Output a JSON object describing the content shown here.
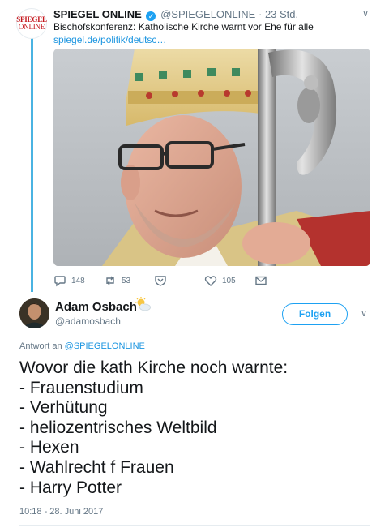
{
  "parent_tweet": {
    "author_name": "SPIEGEL ONLINE",
    "avatar_lines": [
      "SPIEGEL",
      "ONLINE"
    ],
    "verified_icon": "verified-badge-icon",
    "handle": "@SPIEGELONLINE",
    "separator": "·",
    "time": "23 Std.",
    "text": "Bischofskonferenz: Katholische Kirche warnt vor Ehe für alle",
    "link": "spiegel.de/politik/deutsc…",
    "replies": "148",
    "retweets": "53",
    "likes": "105",
    "icons": {
      "reply": "reply-icon",
      "retweet": "retweet-icon",
      "dm": "shield-dm-icon",
      "like": "heart-icon",
      "mail": "envelope-icon"
    },
    "accent_color": "#1da1f2"
  },
  "reply_tweet": {
    "author_name": "Adam Osbach",
    "name_emoji_icon": "sun-behind-cloud-icon",
    "handle": "@adamosbach",
    "follow_label": "Folgen",
    "reply_to_prefix": "Antwort an",
    "reply_to_handle": "@SPIEGELONLINE",
    "body_lines": [
      "Wovor die kath Kirche noch warnte:",
      "- Frauenstudium",
      "- Verhütung",
      "- heliozentrisches Weltbild",
      "- Hexen",
      "- Wahlrecht f Frauen",
      "- Harry Potter"
    ],
    "timestamp": "10:18 - 28. Juni 2017"
  },
  "colors": {
    "link_blue": "#1b95e0",
    "thread_line": "#4ab3e2",
    "muted_text": "#657786",
    "spiegel_red": "#c4161c"
  }
}
